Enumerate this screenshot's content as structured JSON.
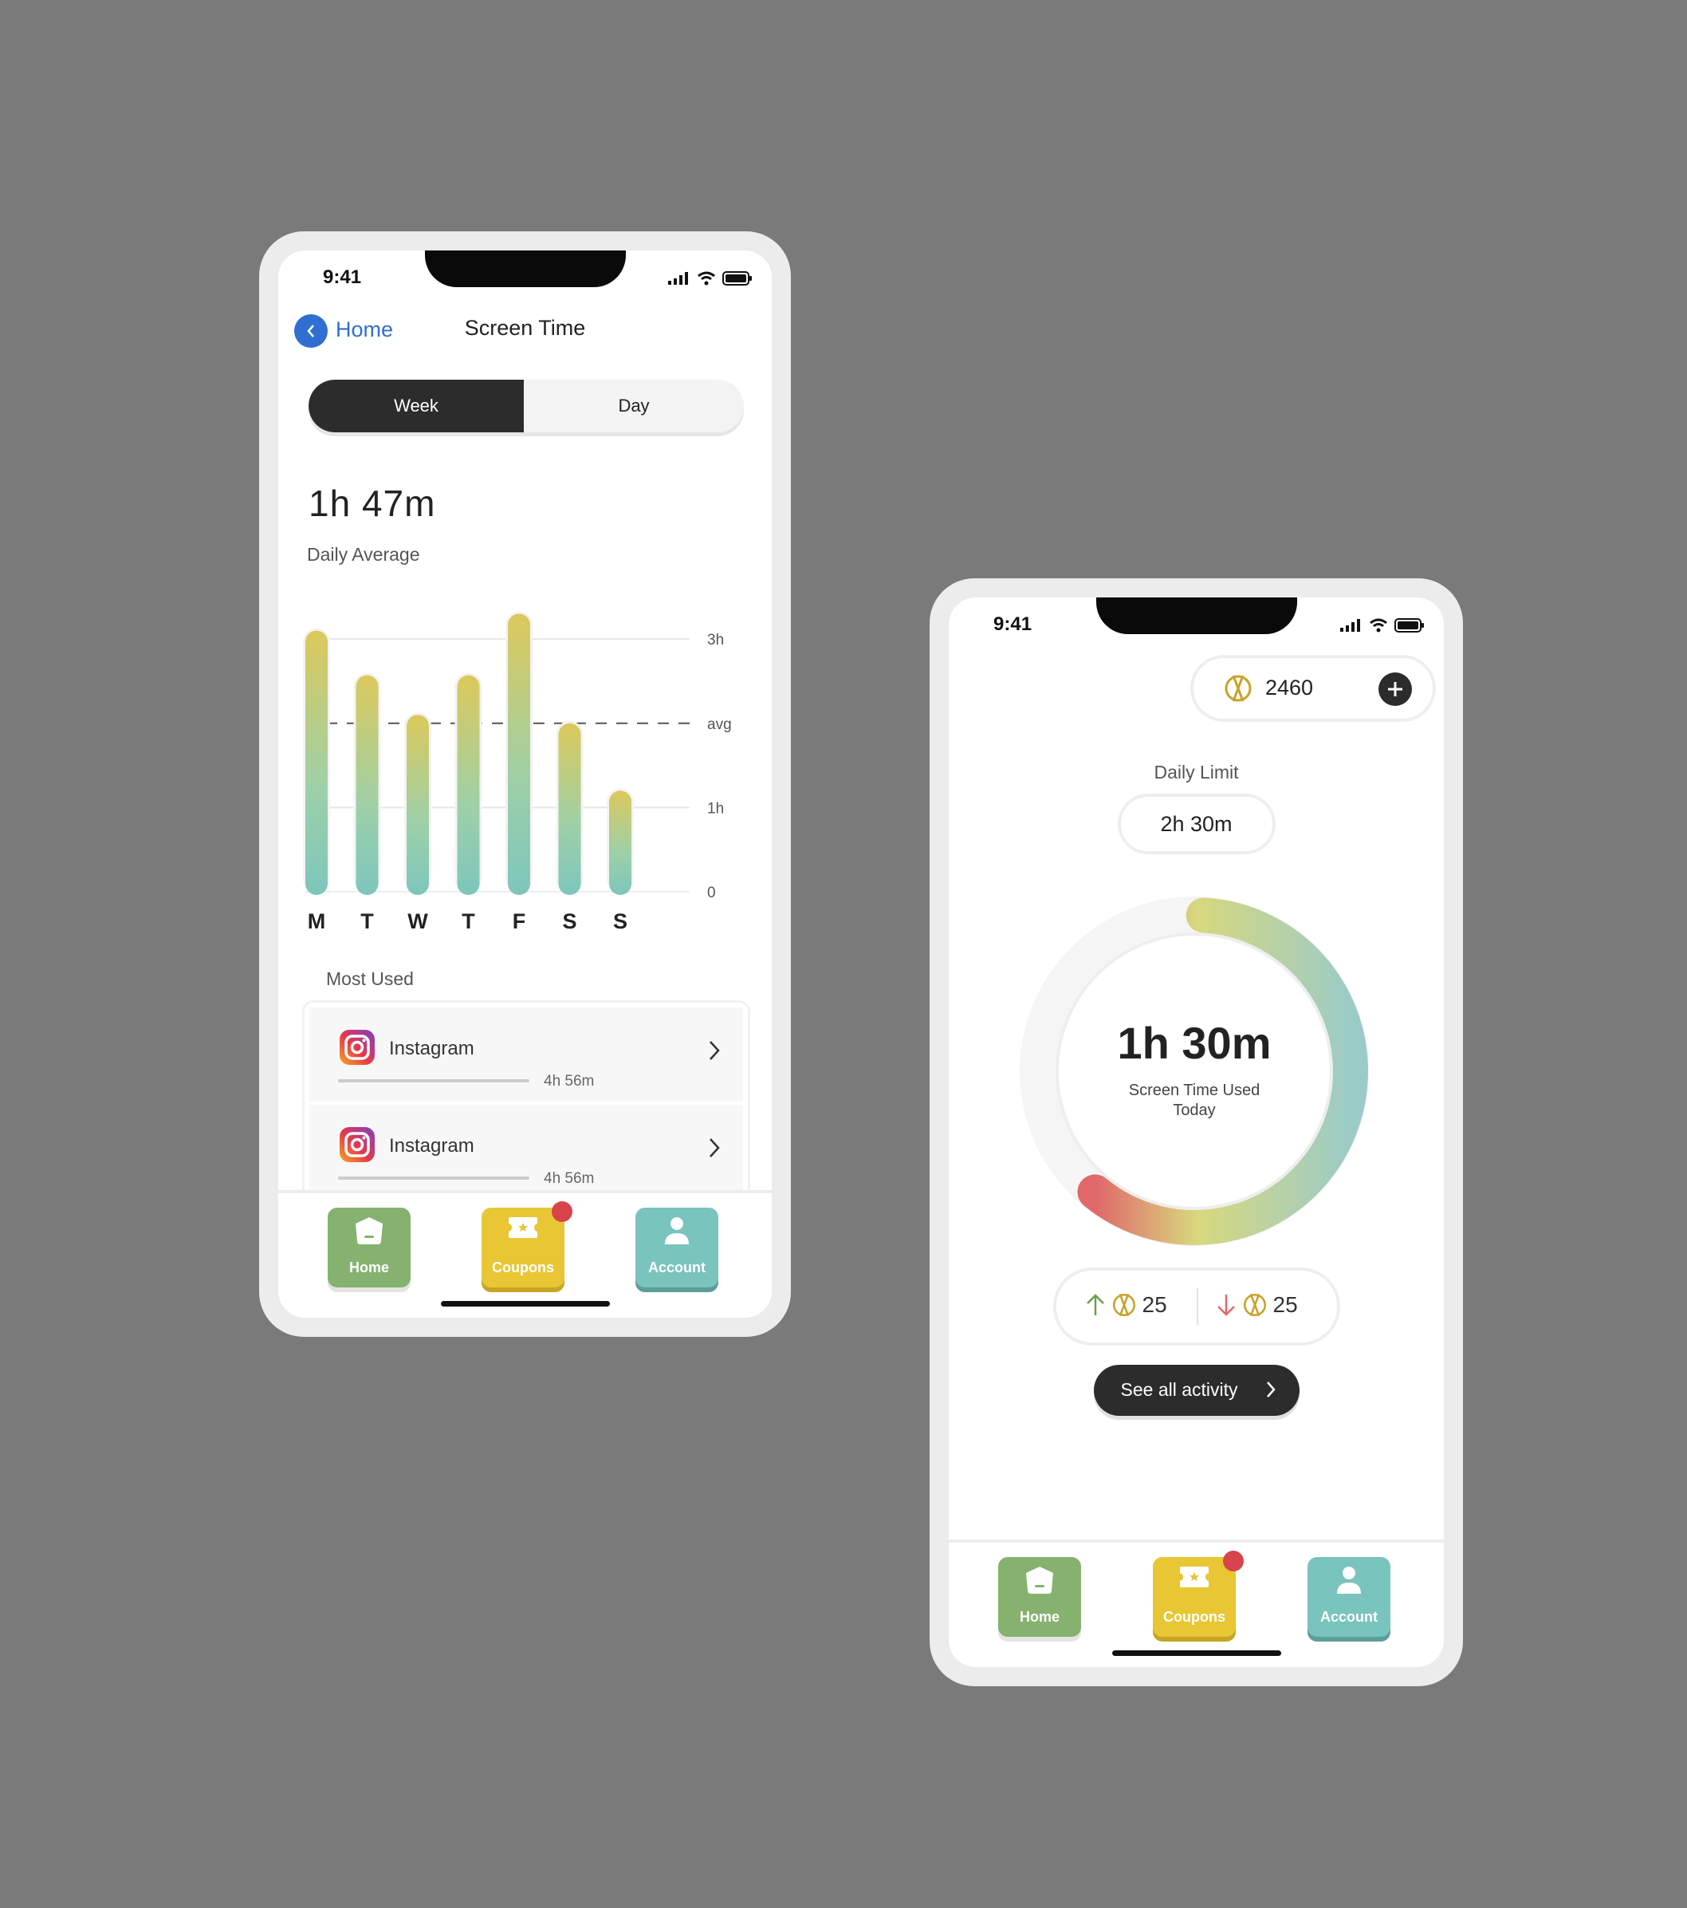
{
  "common": {
    "status_time": "9:41",
    "tabs": [
      {
        "label": "Home",
        "color": "#85b26e"
      },
      {
        "label": "Coupons",
        "color": "#e8c634"
      },
      {
        "label": "Account",
        "color": "#79c4bc"
      }
    ]
  },
  "screen_time": {
    "back_label": "Home",
    "title": "Screen Time",
    "segments": {
      "week": "Week",
      "day": "Day"
    },
    "big_time": "1h 47m",
    "daily_avg_label": "Daily Average",
    "most_used_label": "Most Used",
    "apps": [
      {
        "name": "Instagram",
        "time": "4h 56m"
      },
      {
        "name": "Instagram",
        "time": "4h 56m"
      }
    ]
  },
  "chart_data": {
    "type": "bar",
    "categories": [
      "M",
      "T",
      "W",
      "T",
      "F",
      "S",
      "S"
    ],
    "values": [
      3.1,
      2.57,
      2.1,
      2.57,
      3.3,
      2.0,
      1.2
    ],
    "ylim": [
      0,
      3.2
    ],
    "yticks": [
      {
        "label": "3h",
        "value": 3
      },
      {
        "label": "avg",
        "value": 2.0
      },
      {
        "label": "1h",
        "value": 1
      },
      {
        "label": "0",
        "value": 0
      }
    ],
    "gradient": [
      "#dcc95b",
      "#7dc6bd"
    ],
    "grid": true
  },
  "home": {
    "coins": "2460",
    "daily_limit_label": "Daily Limit",
    "daily_limit_value": "2h 30m",
    "ring_big": "1h 30m",
    "ring_sub": "Screen Time Used Today",
    "ring_progress": 0.6,
    "earned": "25",
    "spent": "25",
    "activity_button": "See all activity"
  }
}
